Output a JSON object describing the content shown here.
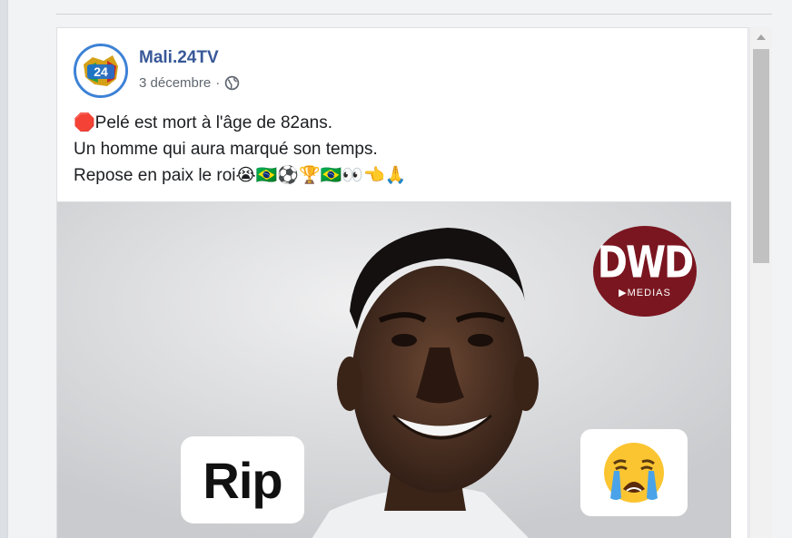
{
  "post": {
    "page_name": "Mali.24TV",
    "date": "3 décembre",
    "separator": "·",
    "privacy_icon": "globe-icon",
    "avatar_text": "24",
    "text_lines": [
      "🛑Pelé est mort à l'âge de 82ans.",
      "Un homme qui aura marqué son temps.",
      "Repose en paix le roi😭🇧🇷⚽🏆🇧🇷👀👈🙏"
    ]
  },
  "image": {
    "rip_label": "Rip",
    "cry_emoji": "😭",
    "logo_main": "DWD",
    "logo_sub": "▶MEDIAS"
  },
  "colors": {
    "link_blue": "#385898",
    "logo_red": "#7a1620"
  }
}
